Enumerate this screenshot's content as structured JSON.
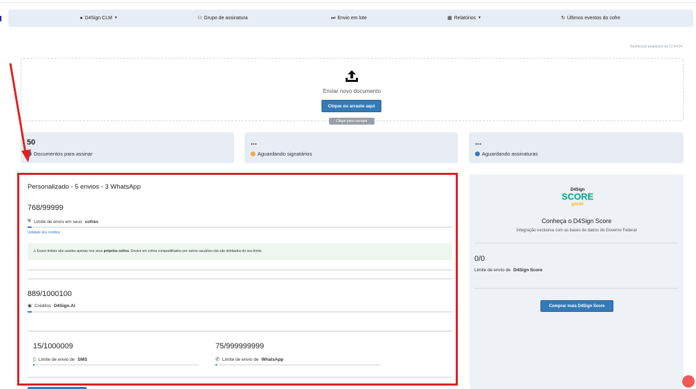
{
  "nav": {
    "items": [
      {
        "label": "D4Sign CLM",
        "icon": "d4sign-icon",
        "dropdown": true
      },
      {
        "label": "Grupo de assinatura",
        "icon": "users-icon",
        "dropdown": false
      },
      {
        "label": "Envio em lote",
        "icon": "fast-forward-icon",
        "dropdown": false
      },
      {
        "label": "Relatórios",
        "icon": "report-icon",
        "dropdown": true
      },
      {
        "label": "Últimos eventos do cofre",
        "icon": "refresh-icon",
        "dropdown": false
      }
    ]
  },
  "dashboard": {
    "updated_text": "Dashboard atualizado às 12:04:04"
  },
  "upload": {
    "title": "Enviar novo documento",
    "button": "Clique ou arraste aqui",
    "tooltip": "Clique para carregar"
  },
  "stats": [
    {
      "value": "50",
      "label": "Documentos para assinar",
      "color": "#337ab7"
    },
    {
      "value": "...",
      "label": "Aguardando signatários",
      "color": "#f0ad4e"
    },
    {
      "value": "...",
      "label": "Aguardando assinaturas",
      "color": "#337ab7"
    }
  ],
  "plan": {
    "title": "Personalizado - 5 envios - 3 WhatsApp",
    "envios": {
      "value": "768/99999",
      "label_prefix": "Limite de envio em seus",
      "label_bold": "cofres",
      "progress": 0.0077
    },
    "validade_link": "Validade dos créditos",
    "notice": {
      "prefix": "Esses limites são usados apenas nos seus",
      "bold": "próprios cofres",
      "suffix": ". Envios em cofres compartilhados por outros usuários não são debitados do seu limite."
    },
    "ai": {
      "value": "889/1000100",
      "label_prefix": "Créditos",
      "label_bold": "D4Sign.AI",
      "progress": 0.0009
    },
    "sms": {
      "value": "15/1000009",
      "label_prefix": "Limite de envio de",
      "label_bold": "SMS",
      "progress": 2e-05
    },
    "whatsapp": {
      "value": "75/999999999",
      "label_prefix": "Limite de envio de",
      "label_bold": "WhatsApp",
      "progress": 1e-07
    }
  },
  "score": {
    "logo_top": "D4Sign",
    "logo_main": "SCORE",
    "logo_sub": "gov.br",
    "title": "Conheça o D4Sign Score",
    "subtitle": "Integração exclusiva com as bases de dados do Governo Federal",
    "value": "0/0",
    "label_prefix": "Limite de envio de",
    "label_bold": "D4Sign Score",
    "buy_button": "Comprar mais D4Sign Score"
  },
  "colors": {
    "primary": "#337ab7",
    "highlight": "#d91f26",
    "nav_bg": "#e7edf6"
  }
}
